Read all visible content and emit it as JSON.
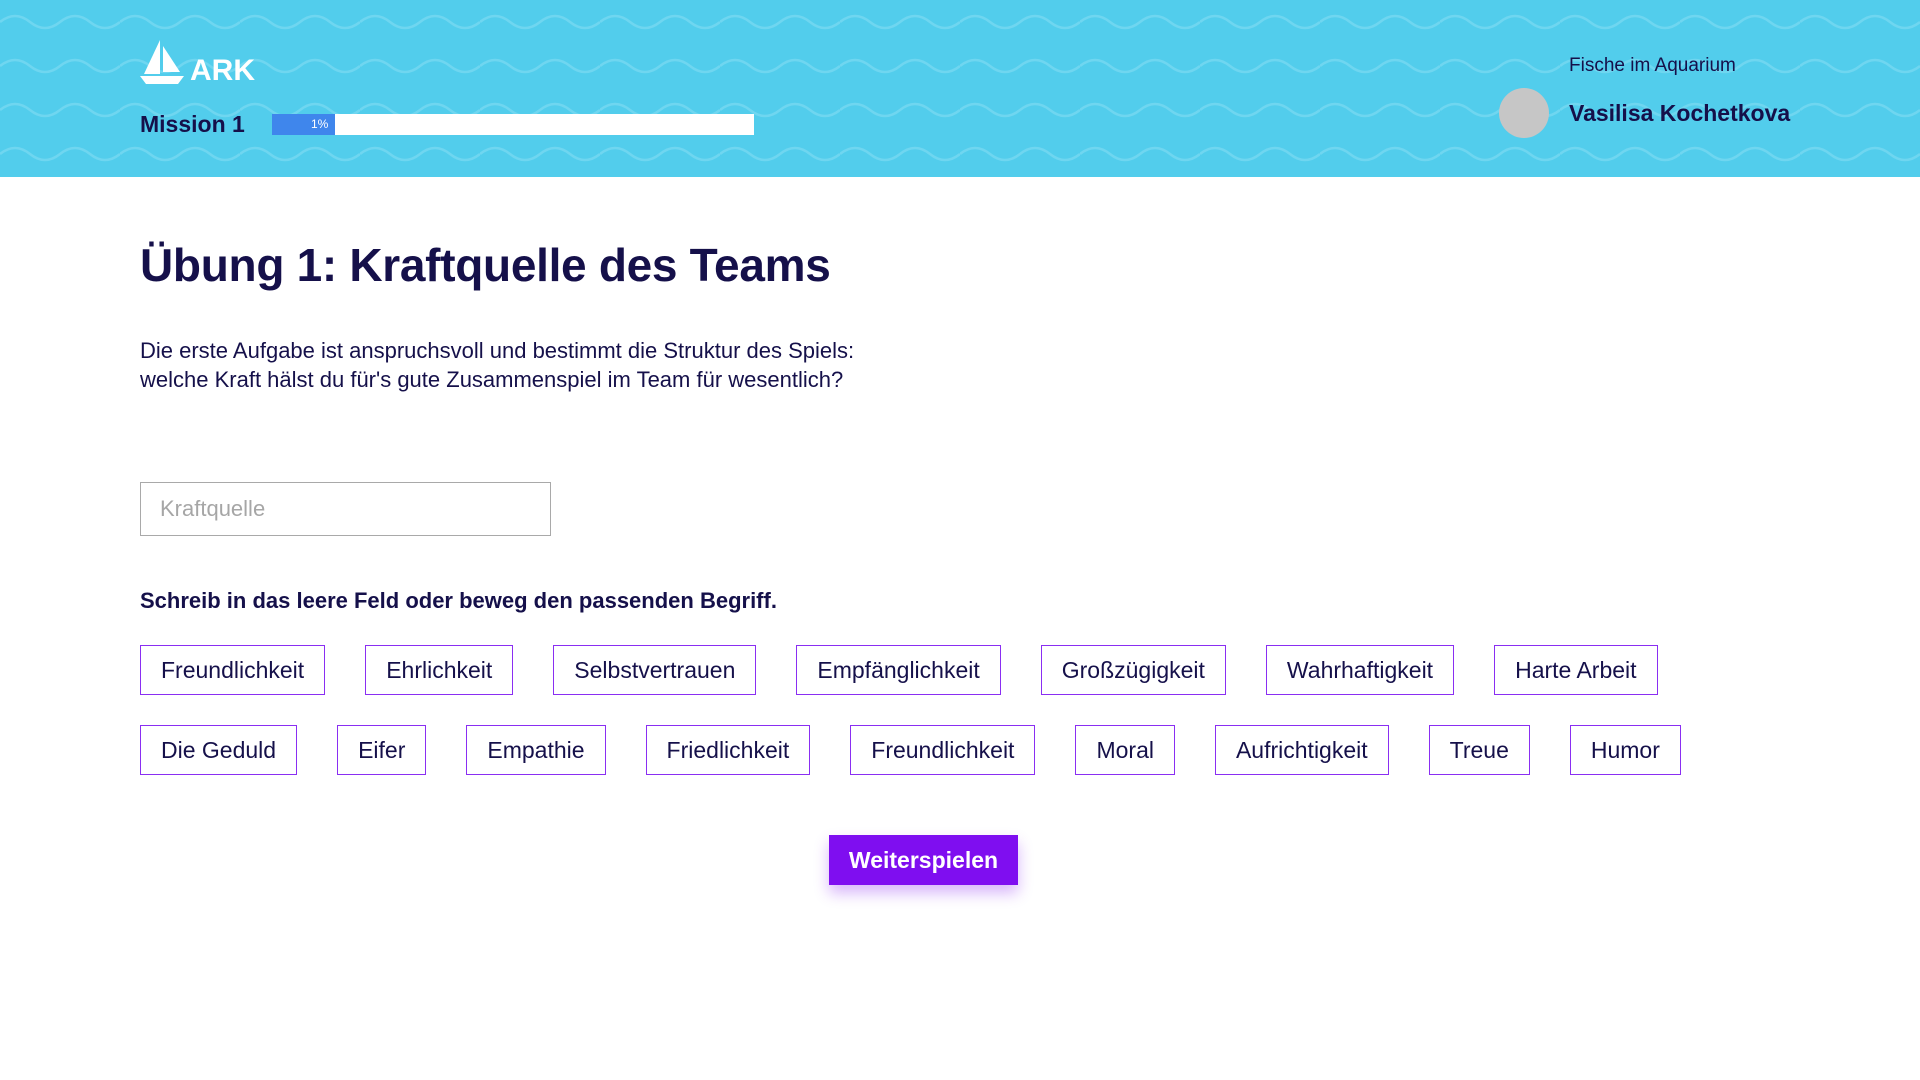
{
  "header": {
    "logo_text": "ARK",
    "logo_icon": "sailboat-icon",
    "mission_label": "Mission 1",
    "progress_percent": 1,
    "progress_label": "1%",
    "team_name": "Fische im Aquarium",
    "user_name": "Vasilisa Kochetkova"
  },
  "main": {
    "title": "Übung 1: Kraftquelle des Teams",
    "description_line1": "Die erste Aufgabe ist anspruchsvoll und bestimmt die Struktur des Spiels:",
    "description_line2": "welche Kraft hälst du für's gute Zusammenspiel im Team für wesentlich?",
    "input_placeholder": "Kraftquelle",
    "input_value": "",
    "hint": "Schreib in das leere Feld oder beweg den passenden Begriff.",
    "chips_row1": [
      "Freundlichkeit",
      "Ehrlichkeit",
      "Selbstvertrauen",
      "Empfänglichkeit",
      "Großzügigkeit",
      "Wahrhaftigkeit",
      "Harte Arbeit"
    ],
    "chips_row2": [
      "Die Geduld",
      "Eifer",
      "Empathie",
      "Friedlichkeit",
      "Freundlichkeit",
      "Moral",
      "Aufrichtigkeit",
      "Treue",
      "Humor"
    ],
    "continue_label": "Weiterspielen"
  },
  "colors": {
    "header_bg": "#52cdec",
    "text_dark": "#15104a",
    "accent_purple": "#7f0ef0",
    "chip_border": "#8a2ef2",
    "progress_fill": "#3f86ec"
  }
}
